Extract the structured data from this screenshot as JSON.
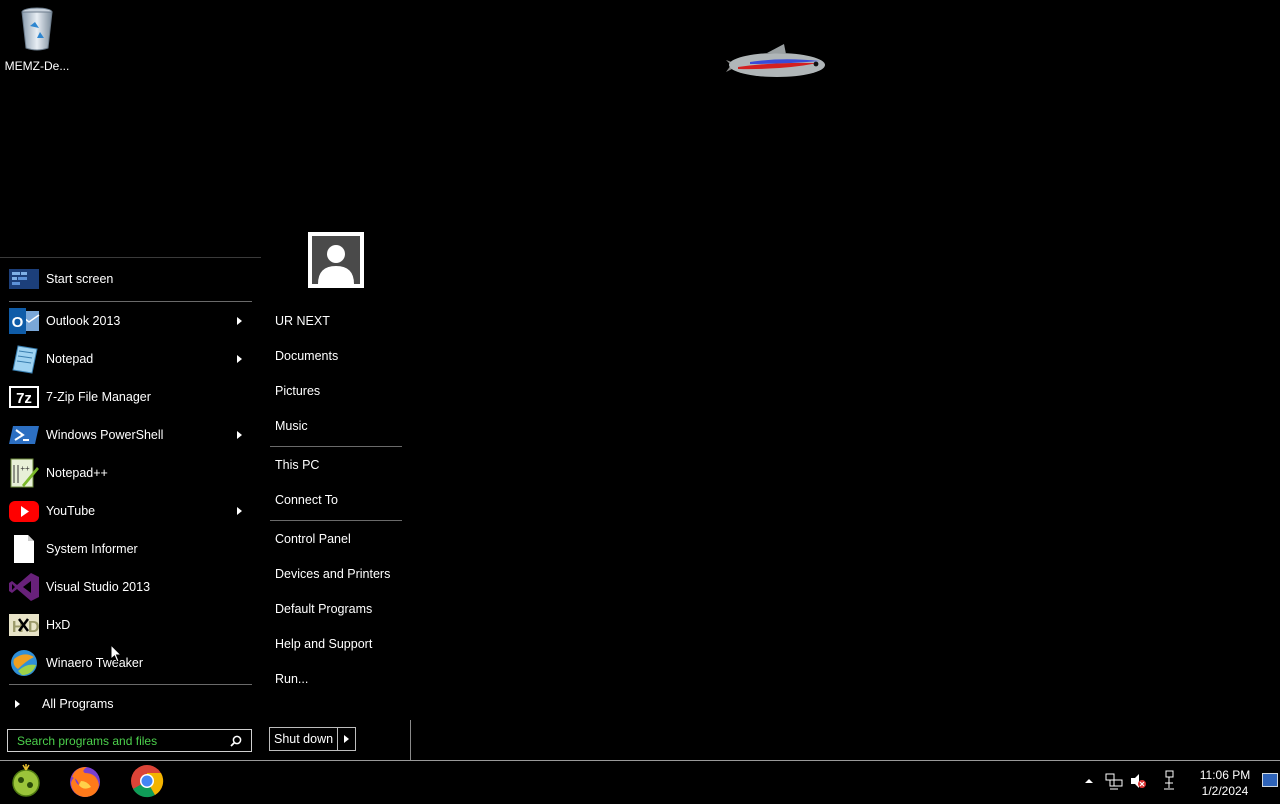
{
  "desktop": {
    "icons": [
      {
        "label": "MEMZ-De...",
        "icon": "recycle-bin-icon"
      }
    ]
  },
  "start_menu": {
    "pinned": [
      {
        "label": "Start screen",
        "icon": "start-screen-icon",
        "submenu": false
      }
    ],
    "recent": [
      {
        "label": "Outlook 2013",
        "icon": "outlook-icon",
        "submenu": true
      },
      {
        "label": "Notepad",
        "icon": "notepad-icon",
        "submenu": true
      },
      {
        "label": "7-Zip File Manager",
        "icon": "7zip-icon",
        "submenu": false
      },
      {
        "label": "Windows PowerShell",
        "icon": "powershell-icon",
        "submenu": true
      },
      {
        "label": "Notepad++",
        "icon": "notepadpp-icon",
        "submenu": false
      },
      {
        "label": "YouTube",
        "icon": "youtube-icon",
        "submenu": true
      },
      {
        "label": "System Informer",
        "icon": "document-icon",
        "submenu": false
      },
      {
        "label": "Visual Studio 2013",
        "icon": "visual-studio-icon",
        "submenu": false
      },
      {
        "label": "HxD",
        "icon": "hxd-icon",
        "submenu": false
      },
      {
        "label": "Winaero Tweaker",
        "icon": "winaero-icon",
        "submenu": false
      }
    ],
    "all_programs_label": "All Programs",
    "search_placeholder": "Search programs and files",
    "right": {
      "user_name": "UR NEXT",
      "group1": [
        "Documents",
        "Pictures",
        "Music"
      ],
      "group2": [
        "This PC",
        "Connect To"
      ],
      "group3": [
        "Control Panel",
        "Devices and Printers",
        "Default Programs",
        "Help and Support",
        "Run..."
      ]
    },
    "shutdown_label": "Shut down"
  },
  "taskbar": {
    "pinned": [
      "start-orb-icon",
      "firefox-icon",
      "chrome-icon"
    ],
    "clock": {
      "time": "11:06 PM",
      "date": "1/2/2024"
    }
  },
  "colors": {
    "search_text": "#4cd04c",
    "background": "#000000"
  }
}
